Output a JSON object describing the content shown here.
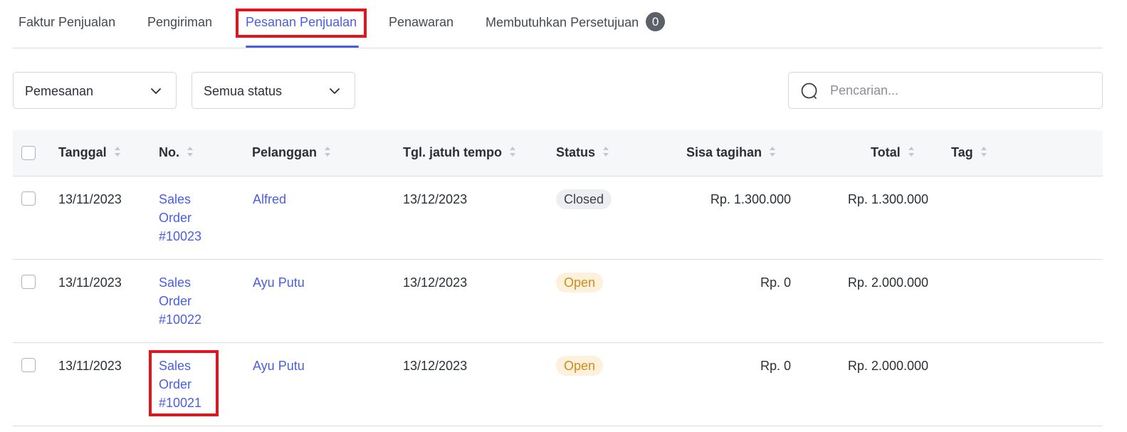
{
  "tabs": [
    {
      "label": "Faktur Penjualan",
      "active": false
    },
    {
      "label": "Pengiriman",
      "active": false
    },
    {
      "label": "Pesanan Penjualan",
      "active": true
    },
    {
      "label": "Penawaran",
      "active": false
    },
    {
      "label": "Membutuhkan Persetujuan",
      "active": false,
      "badge": "0"
    }
  ],
  "filters": {
    "type_select": "Pemesanan",
    "status_select": "Semua status",
    "search_placeholder": "Pencarian..."
  },
  "table": {
    "columns": [
      "Tanggal",
      "No.",
      "Pelanggan",
      "Tgl. jatuh tempo",
      "Status",
      "Sisa tagihan",
      "Total",
      "Tag"
    ],
    "rows": [
      {
        "date": "13/11/2023",
        "no": "Sales Order #10023",
        "customer": "Alfred",
        "due_date": "13/12/2023",
        "status": "Closed",
        "balance": "Rp. 1.300.000",
        "total": "Rp. 1.300.000",
        "tag": ""
      },
      {
        "date": "13/11/2023",
        "no": "Sales Order #10022",
        "customer": "Ayu Putu",
        "due_date": "13/12/2023",
        "status": "Open",
        "balance": "Rp. 0",
        "total": "Rp. 2.000.000",
        "tag": ""
      },
      {
        "date": "13/11/2023",
        "no": "Sales Order #10021",
        "customer": "Ayu Putu",
        "due_date": "13/12/2023",
        "status": "Open",
        "balance": "Rp. 0",
        "total": "Rp. 2.000.000",
        "tag": ""
      }
    ]
  },
  "colors": {
    "accent": "#4a5fe0",
    "highlight": "#e3141e",
    "open_text": "#d48a1c",
    "open_bg": "#fdf1dc",
    "closed_bg": "#eceef1"
  }
}
